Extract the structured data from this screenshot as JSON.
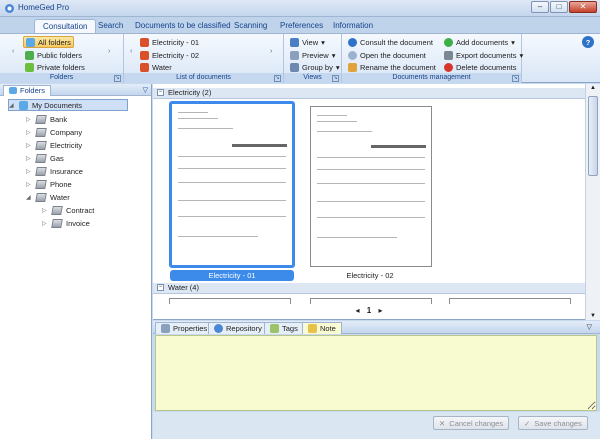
{
  "window": {
    "title": "HomeGed Pro",
    "min": "–",
    "max": "□",
    "close": "✕"
  },
  "tabs": [
    "Consultation",
    "Search",
    "Documents to be classified",
    "Scanning",
    "Preferences",
    "Information"
  ],
  "ribbon": {
    "folders": {
      "items": [
        "All folders",
        "Public folders",
        "Private folders"
      ],
      "label": "Folders"
    },
    "list": {
      "items": [
        "Electricity - 01",
        "Electricity - 02",
        "Water"
      ],
      "label": "List of documents"
    },
    "views": {
      "items": [
        "View",
        "Preview",
        "Group by"
      ],
      "label": "Views"
    },
    "management": {
      "col1": [
        "Consult the document",
        "Open the document",
        "Rename the document"
      ],
      "col2": [
        "Add documents",
        "Export documents",
        "Delete documents"
      ],
      "label": "Documents management"
    },
    "help": "?"
  },
  "left_panel": {
    "title": "Folders",
    "tree": [
      "My Documents",
      "Bank",
      "Company",
      "Electricity",
      "Gas",
      "Insurance",
      "Phone",
      "Water",
      "Contract",
      "Invoice"
    ]
  },
  "docs": {
    "groups": [
      "Electricity (2)",
      "Water (4)"
    ],
    "cards": [
      "Electricity - 01",
      "Electricity - 02"
    ],
    "pager": {
      "prev": "◂",
      "page": "1",
      "next": "▸"
    }
  },
  "bottom": {
    "tabs": [
      "Properties",
      "Repository",
      "Tags",
      "Note"
    ],
    "cancel": "Cancel changes",
    "save": "Save changes"
  },
  "colors": {
    "accent": "#3c8bea",
    "ribbon": "#dbe6f3",
    "note_bg": "#f7fbcf"
  }
}
